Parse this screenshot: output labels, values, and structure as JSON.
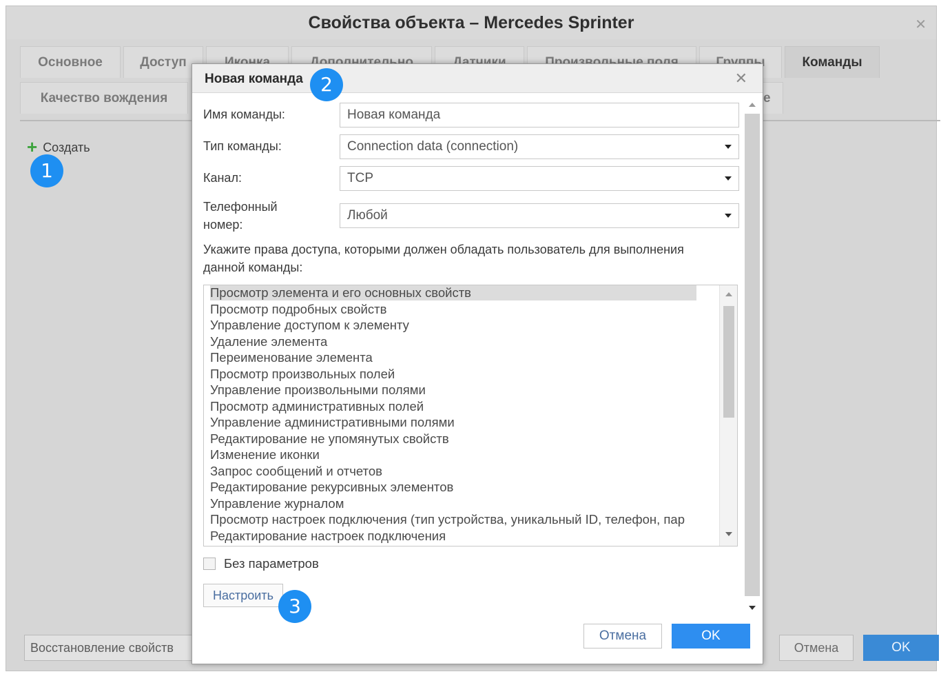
{
  "window": {
    "title": "Свойства объекта – Mercedes Sprinter",
    "close_icon": "close-icon"
  },
  "tabs": [
    {
      "label": "Основное",
      "active": false
    },
    {
      "label": "Доступ",
      "active": false
    },
    {
      "label": "Иконка",
      "active": false
    },
    {
      "label": "Дополнительно",
      "active": false
    },
    {
      "label": "Датчики",
      "active": false
    },
    {
      "label": "Произвольные поля",
      "active": false
    },
    {
      "label": "Группы",
      "active": false
    },
    {
      "label": "Команды",
      "active": true
    },
    {
      "label": "Качество вождения",
      "active": false
    },
    {
      "label": "е",
      "active": false
    }
  ],
  "toolbar": {
    "create_label": "Создать",
    "create_icon": "plus-icon"
  },
  "footer": {
    "restore_label": "Восстановление свойств",
    "cancel_label": "Отмена",
    "ok_label": "OK"
  },
  "badges": {
    "one": "1",
    "two": "2",
    "three": "3"
  },
  "dialog": {
    "title": "Новая команда",
    "fields": {
      "name_label": "Имя команды:",
      "name_value": "Новая команда",
      "type_label": "Тип команды:",
      "type_value": "Connection data (connection)",
      "channel_label": "Канал:",
      "channel_value": "TCP",
      "phone_label_1": "Телефонный",
      "phone_label_2": "номер:",
      "phone_value": "Любой"
    },
    "rights_text_1": "Укажите права доступа, которыми должен обладать пользователь для выполнения",
    "rights_text_2": "данной команды:",
    "permissions": [
      "Просмотр элемента и его основных свойств",
      "Просмотр подробных свойств",
      "Управление доступом к элементу",
      "Удаление элемента",
      "Переименование элемента",
      "Просмотр произвольных полей",
      "Управление произвольными полями",
      "Просмотр административных полей",
      "Управление административными полями",
      "Редактирование не упомянутых свойств",
      "Изменение иконки",
      "Запрос сообщений и отчетов",
      "Редактирование рекурсивных элементов",
      "Управление журналом",
      "Просмотр настроек подключения (тип устройства, уникальный ID, телефон, пар",
      "Редактирование настроек подключения"
    ],
    "selected_permission": "Просмотр элемента и его основных свойств",
    "no_params_label": "Без параметров",
    "configure_label": "Настроить",
    "cancel_label": "Отмена",
    "ok_label": "OK"
  },
  "colors": {
    "accent": "#2e8ef0",
    "badge": "#1e8ff2",
    "plus": "#3ea33e"
  }
}
